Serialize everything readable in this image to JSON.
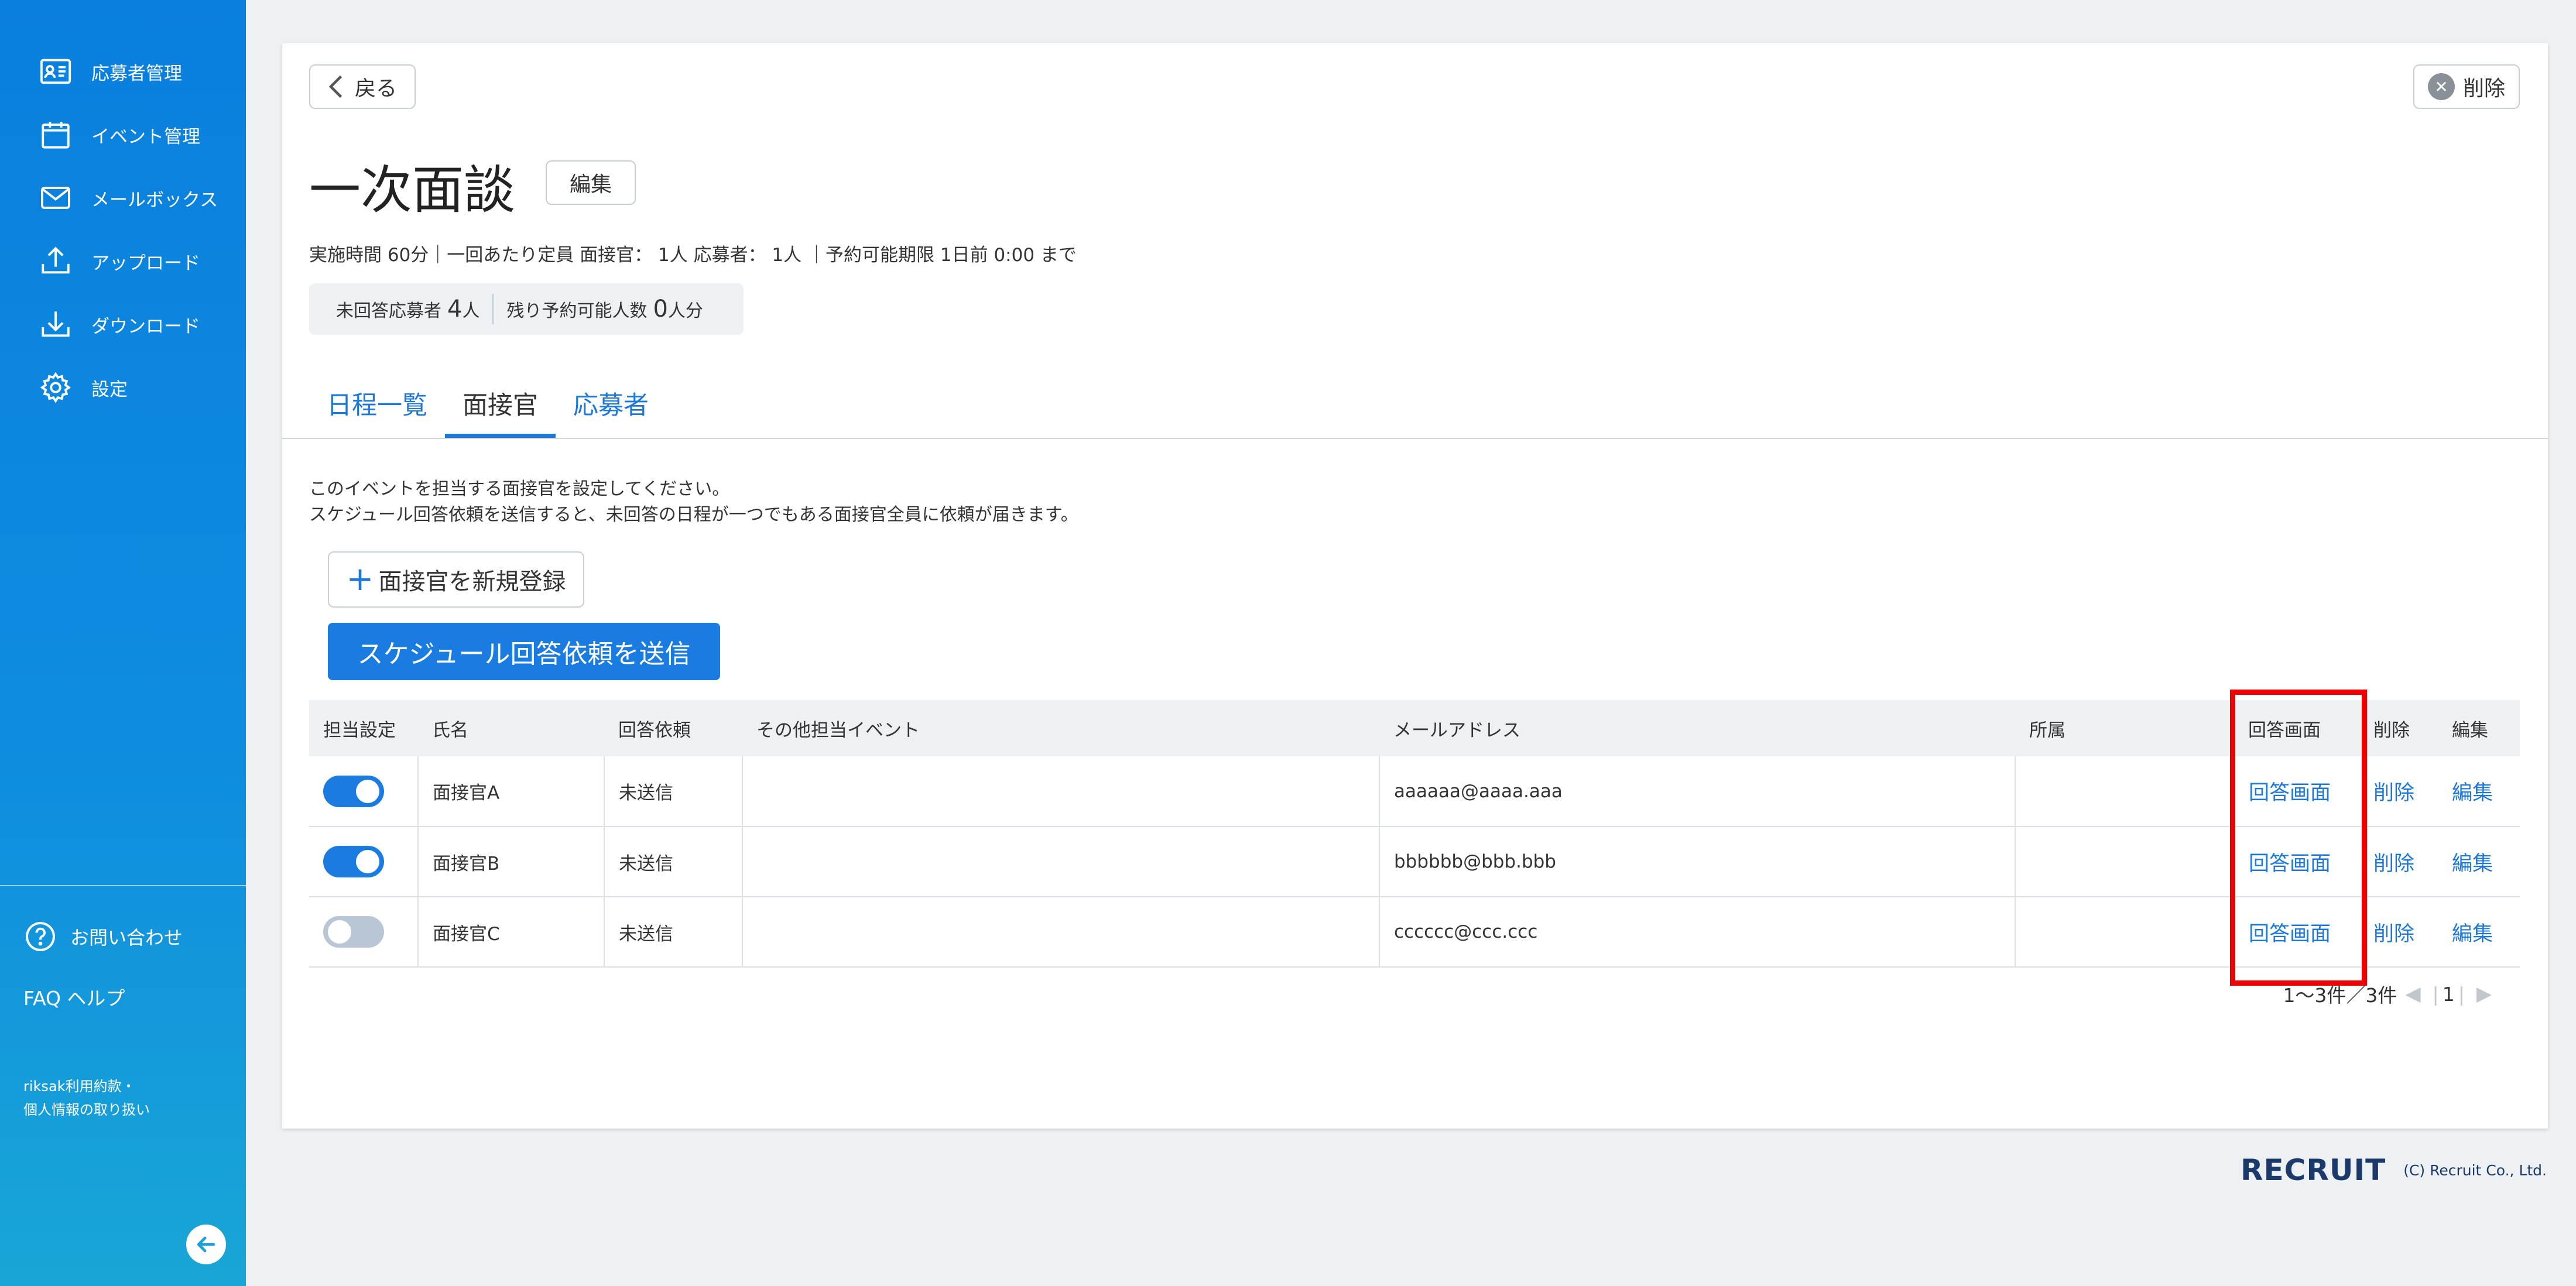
{
  "sidebar": {
    "items": [
      {
        "label": "応募者管理",
        "icon": "id-card-icon"
      },
      {
        "label": "イベント管理",
        "icon": "calendar-icon"
      },
      {
        "label": "メールボックス",
        "icon": "mail-icon"
      },
      {
        "label": "アップロード",
        "icon": "upload-icon"
      },
      {
        "label": "ダウンロード",
        "icon": "download-icon"
      },
      {
        "label": "設定",
        "icon": "gear-icon"
      }
    ],
    "contact": "お問い合わせ",
    "faq": "FAQ ヘルプ",
    "terms_line1": "riksak利用約款・",
    "terms_line2": "個人情報の取り扱い"
  },
  "header": {
    "back_label": "戻る",
    "delete_label": "削除",
    "title": "一次面談",
    "edit_label": "編集",
    "meta": "実施時間 60分｜一回あたり定員 面接官： 1人 応募者： 1人 ｜予約可能期限 1日前 0:00 まで",
    "stats": {
      "unanswered_label": "未回答応募者",
      "unanswered_count": "4",
      "unanswered_unit": "人",
      "remaining_label": "残り予約可能人数",
      "remaining_count": "0",
      "remaining_unit": "人分"
    }
  },
  "tabs": [
    {
      "label": "日程一覧",
      "active": false
    },
    {
      "label": "面接官",
      "active": true
    },
    {
      "label": "応募者",
      "active": false
    }
  ],
  "instructions": {
    "line1": "このイベントを担当する面接官を設定してください。",
    "line2": "スケジュール回答依頼を送信すると、未回答の日程が一つでもある面接官全員に依頼が届きます。"
  },
  "actions": {
    "new_label": "面接官を新規登録",
    "send_label": "スケジュール回答依頼を送信"
  },
  "table": {
    "columns": [
      "担当設定",
      "氏名",
      "回答依頼",
      "その他担当イベント",
      "メールアドレス",
      "所属",
      "回答画面",
      "削除",
      "編集"
    ],
    "rows": [
      {
        "assigned": true,
        "name": "面接官A",
        "status": "未送信",
        "other": "",
        "email": "aaaaaa@aaaa.aaa",
        "dept": "",
        "answer": "回答画面",
        "delete": "削除",
        "edit": "編集"
      },
      {
        "assigned": true,
        "name": "面接官B",
        "status": "未送信",
        "other": "",
        "email": "bbbbbb@bbb.bbb",
        "dept": "",
        "answer": "回答画面",
        "delete": "削除",
        "edit": "編集"
      },
      {
        "assigned": false,
        "name": "面接官C",
        "status": "未送信",
        "other": "",
        "email": "cccccc@ccc.ccc",
        "dept": "",
        "answer": "回答画面",
        "delete": "削除",
        "edit": "編集"
      }
    ]
  },
  "pagination": {
    "summary": "1～3件／3件",
    "page": "1"
  },
  "footer": {
    "logo": "RECRUIT",
    "copyright": "(C) Recruit Co., Ltd."
  },
  "colors": {
    "accent": "#1a7ce0",
    "sidebar": "#0a7fde",
    "highlight": "#ee0000"
  }
}
